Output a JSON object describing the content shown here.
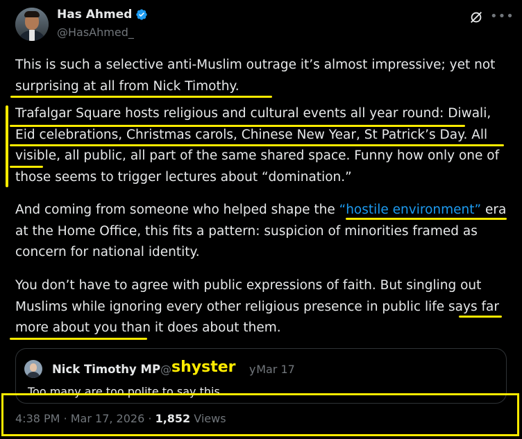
{
  "author": {
    "name": "Has Ahmed",
    "handle": "@HasAhmed_",
    "verified_color": "#1d9bf0"
  },
  "tweet": {
    "p1": {
      "t1": "This is such a selective anti-Muslim outrage it’s almost impressive; yet not surprising at all from Nick Timothy."
    },
    "p2": {
      "t1": "Trafalgar Square hosts religious and cultural events all year round: Diwali, Eid celebrations, Christmas carols, Chinese New Year, St Patrick’s Day. All visible, all public, all part of the same shared space. Funny how only one of those seems to trigger lectures about “domination.”"
    },
    "p3": {
      "before": "And coming from someone who helped shape the ",
      "link": "“hostile environment”",
      "after": " era at the Home Office, this fits a pattern: suspicion of minorities framed as concern for national identity."
    },
    "p4": {
      "t1": "You don’t have to agree with public expressions of faith. But singling out Muslims while ignoring every other religious presence in public life says far more about you than it does about them."
    }
  },
  "quote": {
    "name": "Nick Timothy MP",
    "handle": "@",
    "handle_tail": "y",
    "sticker": "shyster",
    "sep": "·",
    "date": "Mar 17",
    "text": "Too many are too polite to say this"
  },
  "meta": {
    "time": "4:38 PM",
    "sep1": "·",
    "date": "Mar 17, 2026",
    "sep2": "·",
    "views": "1,852",
    "views_label": "Views"
  },
  "icons": [
    "verified-badge-icon",
    "grok-icon",
    "more-icon"
  ],
  "colors": {
    "background": "#000000",
    "text": "#e7e9ea",
    "muted": "#71767b",
    "link": "#1d9bf0",
    "highlight": "#ffeb00"
  }
}
